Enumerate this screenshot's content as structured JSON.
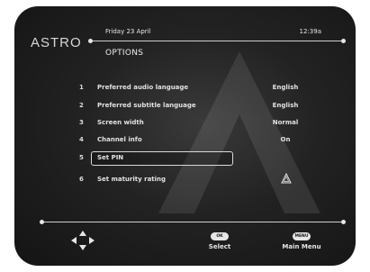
{
  "brand": {
    "logo_text": "ASTRO"
  },
  "header": {
    "date": "Friday 23 April",
    "time": "12:39a",
    "title": "OPTIONS"
  },
  "menu": {
    "items": [
      {
        "number": "1",
        "label": "Preferred audio language",
        "value": "English"
      },
      {
        "number": "2",
        "label": "Preferred subtitle language",
        "value": "English"
      },
      {
        "number": "3",
        "label": "Screen width",
        "value": "Normal"
      },
      {
        "number": "4",
        "label": "Channel info",
        "value": "On"
      },
      {
        "number": "5",
        "label": "Set PIN",
        "value": "",
        "selected": true
      },
      {
        "number": "6",
        "label": "Set maturity rating",
        "value": "",
        "icon": "warning-triangle-icon"
      }
    ]
  },
  "footer": {
    "nav_icon": "direction-arrows-icon",
    "ok_button": {
      "key": "OK",
      "label": "Select"
    },
    "menu_button": {
      "key": "MENU",
      "label": "Main Menu"
    }
  },
  "colors": {
    "background": "#1e1e1e",
    "text": "#e6e6e6",
    "frame": "#ffffff"
  }
}
